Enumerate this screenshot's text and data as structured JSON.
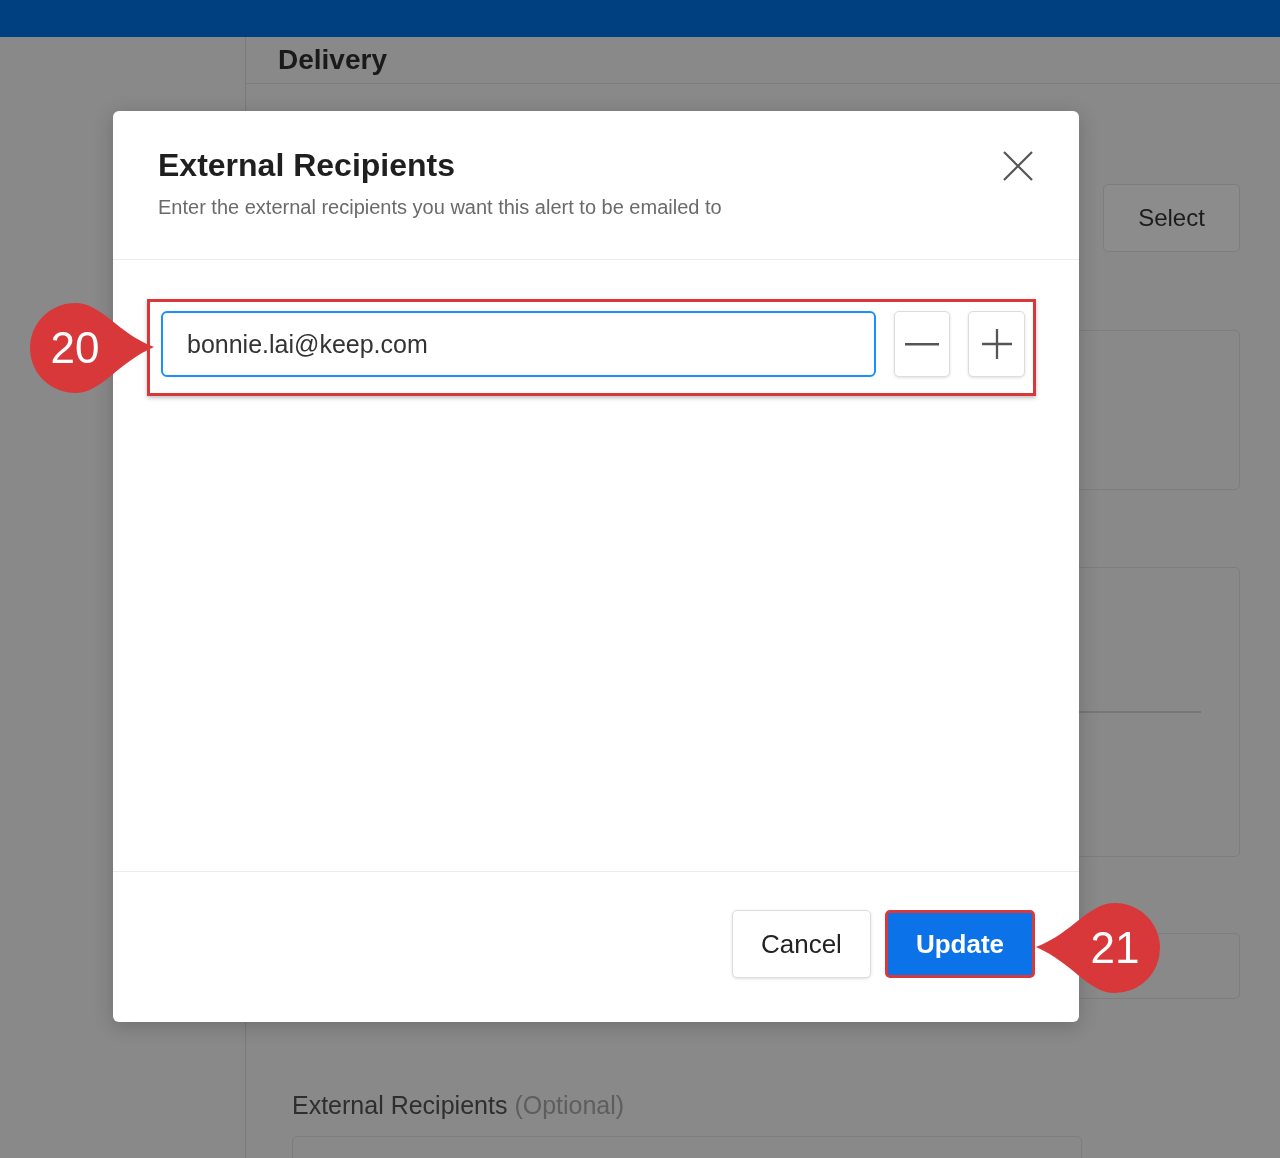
{
  "page": {
    "heading": "Delivery",
    "select_button": "Select",
    "field_label": "External Recipients",
    "field_hint": "(Optional)"
  },
  "dialog": {
    "title": "External Recipients",
    "subtitle": "Enter the external recipients you want this alert to be emailed to",
    "recipients": [
      {
        "value": "bonnie.lai@keep.com",
        "focused": true,
        "highlighted": true
      }
    ],
    "buttons": [
      {
        "label": "Cancel",
        "kind": "secondary",
        "highlighted": false
      },
      {
        "label": "Update",
        "kind": "primary",
        "highlighted": true
      }
    ]
  },
  "annotations": [
    {
      "number": "20",
      "kind": "right"
    },
    {
      "number": "21",
      "kind": "left"
    }
  ]
}
